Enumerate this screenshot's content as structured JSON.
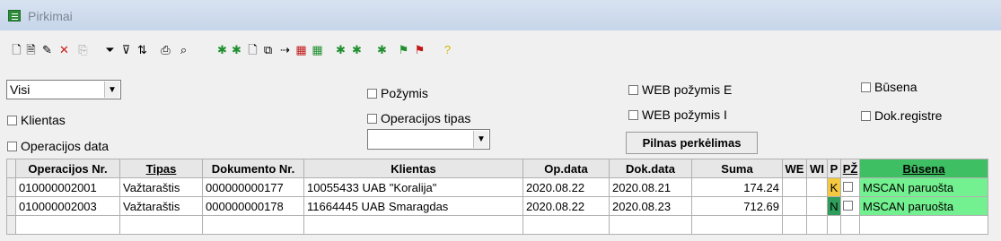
{
  "window": {
    "title": "Pirkimai"
  },
  "toolbar": {
    "icons": [
      {
        "name": "new-document-icon",
        "glyph": "🗋"
      },
      {
        "name": "view-document-icon",
        "glyph": "🗎"
      },
      {
        "name": "edit-icon",
        "glyph": "✎"
      },
      {
        "name": "delete-icon",
        "glyph": "✕",
        "color": "#d01818"
      },
      {
        "name": "copy-icon",
        "glyph": "⎘",
        "color": "#9a9a9a"
      },
      {
        "name": "filter-funnel-list-icon",
        "glyph": "⏷"
      },
      {
        "name": "filter-icon",
        "glyph": "⊽"
      },
      {
        "name": "sort-az-icon",
        "glyph": "⇅"
      },
      {
        "name": "print-icon",
        "glyph": "⎙"
      },
      {
        "name": "binoculars-icon",
        "glyph": "⌕"
      },
      {
        "name": "import-icon-1",
        "glyph": "✱",
        "color": "#1f8f2f"
      },
      {
        "name": "import-icon-2",
        "glyph": "✱",
        "color": "#1f8f2f"
      },
      {
        "name": "blank-page-icon",
        "glyph": "🗋"
      },
      {
        "name": "link-icon",
        "glyph": "⧉"
      },
      {
        "name": "transfer-icon",
        "glyph": "⇢"
      },
      {
        "name": "building-red-icon",
        "glyph": "▦",
        "color": "#c01818"
      },
      {
        "name": "building-green-icon",
        "glyph": "▦",
        "color": "#1f8f2f"
      },
      {
        "name": "export-icon-1",
        "glyph": "✱",
        "color": "#1f8f2f"
      },
      {
        "name": "export-icon-2",
        "glyph": "✱",
        "color": "#1f8f2f"
      },
      {
        "name": "upload-icon",
        "glyph": "✱",
        "color": "#1f8f2f"
      },
      {
        "name": "green-flag-icon",
        "glyph": "⚑",
        "color": "#1f8f2f"
      },
      {
        "name": "red-flag-icon",
        "glyph": "⚑",
        "color": "#c01818"
      },
      {
        "name": "help-icon",
        "glyph": "?",
        "color": "#d8b400"
      }
    ]
  },
  "filters": {
    "period_select": {
      "value": "Visi"
    },
    "klientas_label": "Klientas",
    "operacijos_data_label": "Operacijos data",
    "pozymis_label": "Požymis",
    "operacijos_tipas_label": "Operacijos tipas",
    "operacijos_tipas_select": {
      "value": ""
    },
    "web_pozymis_e_label": "WEB požymis E",
    "web_pozymis_i_label": "WEB požymis I",
    "pilnas_perkelimas_label": "Pilnas perkėlimas",
    "busena_label": "Būsena",
    "dok_registre_label": "Dok.registre"
  },
  "table": {
    "columns": [
      "Operacijos Nr.",
      "Tipas",
      "Dokumento Nr.",
      "Klientas",
      "Op.data",
      "Dok.data",
      "Suma",
      "WE",
      "WI",
      "P",
      "PŽ",
      "Būsena"
    ],
    "rows": [
      {
        "op_nr": "010000002001",
        "tipas": "Važtaraštis",
        "dok_nr": "000000000177",
        "klientas": "10055433  UAB \"Koralija\"",
        "op_data": "2020.08.22",
        "dok_data": "2020.08.21",
        "suma": "174.24",
        "we": "",
        "wi": "",
        "p": "K",
        "p_color": "#f5c842",
        "pz": "",
        "busena": "MSCAN paruošta"
      },
      {
        "op_nr": "010000002003",
        "tipas": "Važtaraštis",
        "dok_nr": "000000000178",
        "klientas": "11664445  UAB Smaragdas",
        "op_data": "2020.08.22",
        "dok_data": "2020.08.23",
        "suma": "712.69",
        "we": "",
        "wi": "",
        "p": "N",
        "p_color": "#2f9e5c",
        "pz": "",
        "busena": "MSCAN paruošta"
      }
    ]
  }
}
